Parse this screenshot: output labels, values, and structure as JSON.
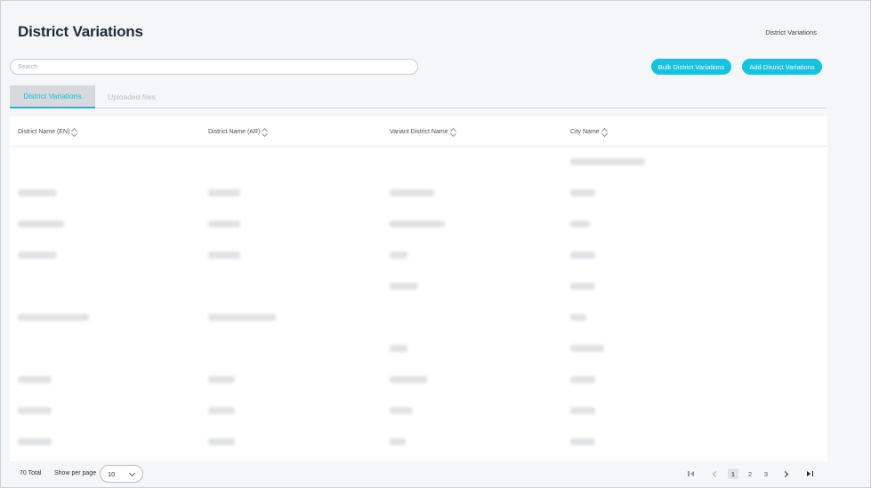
{
  "header": {
    "title": "District Variations",
    "breadcrumb": "District Variations"
  },
  "search": {
    "placeholder": "Search"
  },
  "actions": {
    "bulk_label": "Bulk District Variations",
    "add_label": "Add District Variations"
  },
  "colors": {
    "accent": "#15c2e0",
    "tab_active_bg": "#d6dadd"
  },
  "tabs": [
    {
      "label": "District Variations",
      "active": true
    },
    {
      "label": "Uploaded files",
      "active": false
    }
  ],
  "table": {
    "columns": [
      {
        "label": "District Name (EN)"
      },
      {
        "label": "District Name (AR)"
      },
      {
        "label": "Variant District Name"
      },
      {
        "label": "City Name"
      }
    ],
    "rows_blurred": true
  },
  "footer": {
    "total": "70 Total",
    "per_page_label": "Show per page",
    "per_page_value": "10",
    "pages": [
      "1",
      "2",
      "3"
    ],
    "current_page": "1"
  }
}
